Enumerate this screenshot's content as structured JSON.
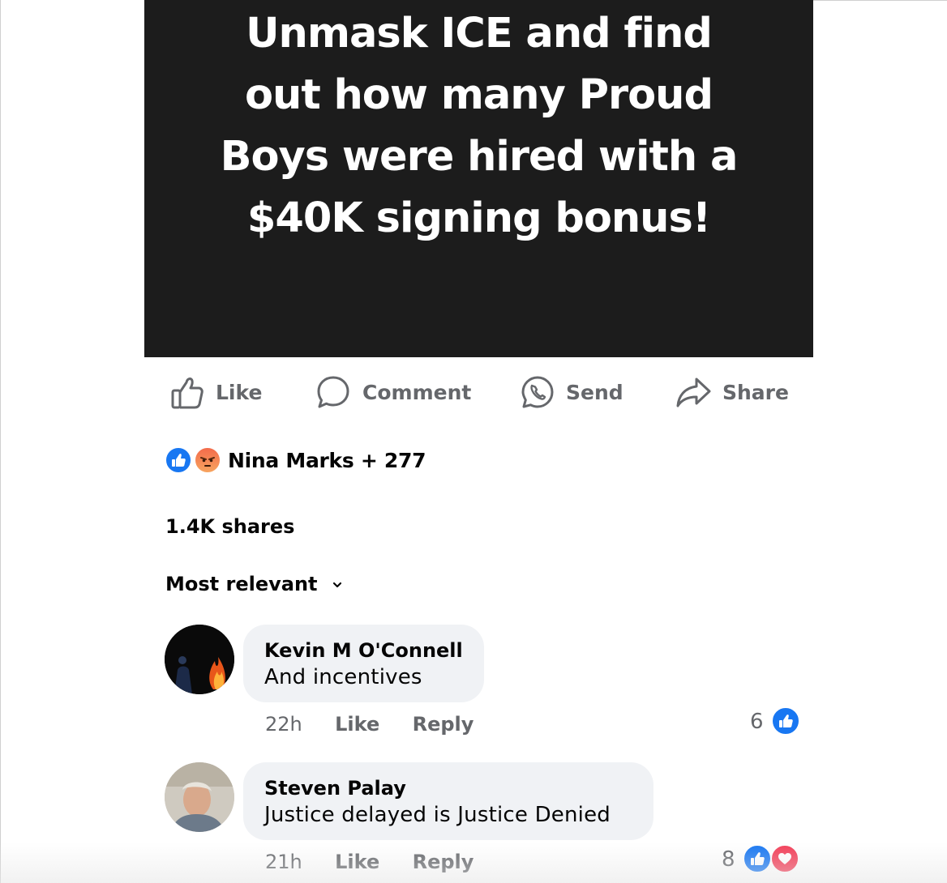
{
  "post": {
    "image_text": [
      "Unmask ICE and find",
      "out how many Proud",
      "Boys were hired with a",
      "$40K signing bonus!"
    ]
  },
  "actions": {
    "like": "Like",
    "comment": "Comment",
    "send": "Send",
    "share": "Share"
  },
  "reactions": {
    "summary": "Nina Marks + 277",
    "icons": [
      "like-icon",
      "angry-icon"
    ]
  },
  "shares_text": "1.4K shares",
  "sort_label": "Most relevant",
  "comments": [
    {
      "author": "Kevin M O'Connell",
      "text": "And incentives",
      "time": "22h",
      "like_label": "Like",
      "reply_label": "Reply",
      "reaction_count": "6",
      "reaction_icons": [
        "like-icon"
      ]
    },
    {
      "author": "Steven Palay",
      "text": "Justice delayed is Justice Denied",
      "time": "21h",
      "like_label": "Like",
      "reply_label": "Reply",
      "reaction_count": "8",
      "reaction_icons": [
        "like-icon",
        "love-icon"
      ]
    }
  ],
  "colors": {
    "post_bg": "#1c1c1c",
    "action_grey": "#65676b",
    "like_blue": "#1877f2",
    "love_red": "#f33e58",
    "bubble_bg": "#f0f2f5"
  }
}
